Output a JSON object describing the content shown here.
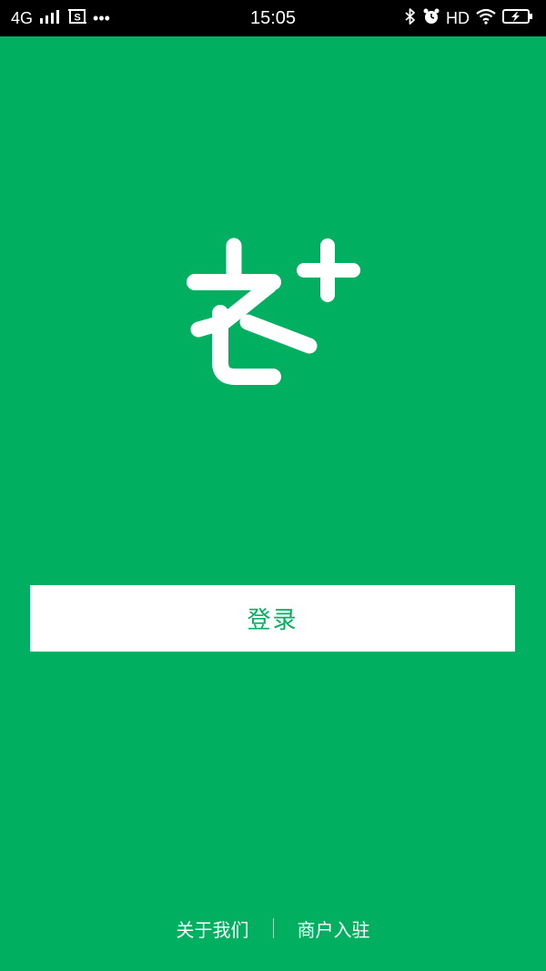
{
  "status_bar": {
    "network": "4G",
    "time": "15:05",
    "hd_label": "HD",
    "more_dots": "•••",
    "icons": [
      "signal-icon",
      "screenshot-icon",
      "bluetooth-icon",
      "alarm-icon",
      "wifi-icon",
      "battery-charging-icon"
    ]
  },
  "colors": {
    "brand_green": "#00b060",
    "button_bg": "#ffffff",
    "status_bar_bg": "#000000"
  },
  "logo": {
    "icon": "nong-plus-logo-icon"
  },
  "login_button": {
    "label": "登录"
  },
  "footer": {
    "about_label": "关于我们",
    "merchant_label": "商户入驻"
  }
}
